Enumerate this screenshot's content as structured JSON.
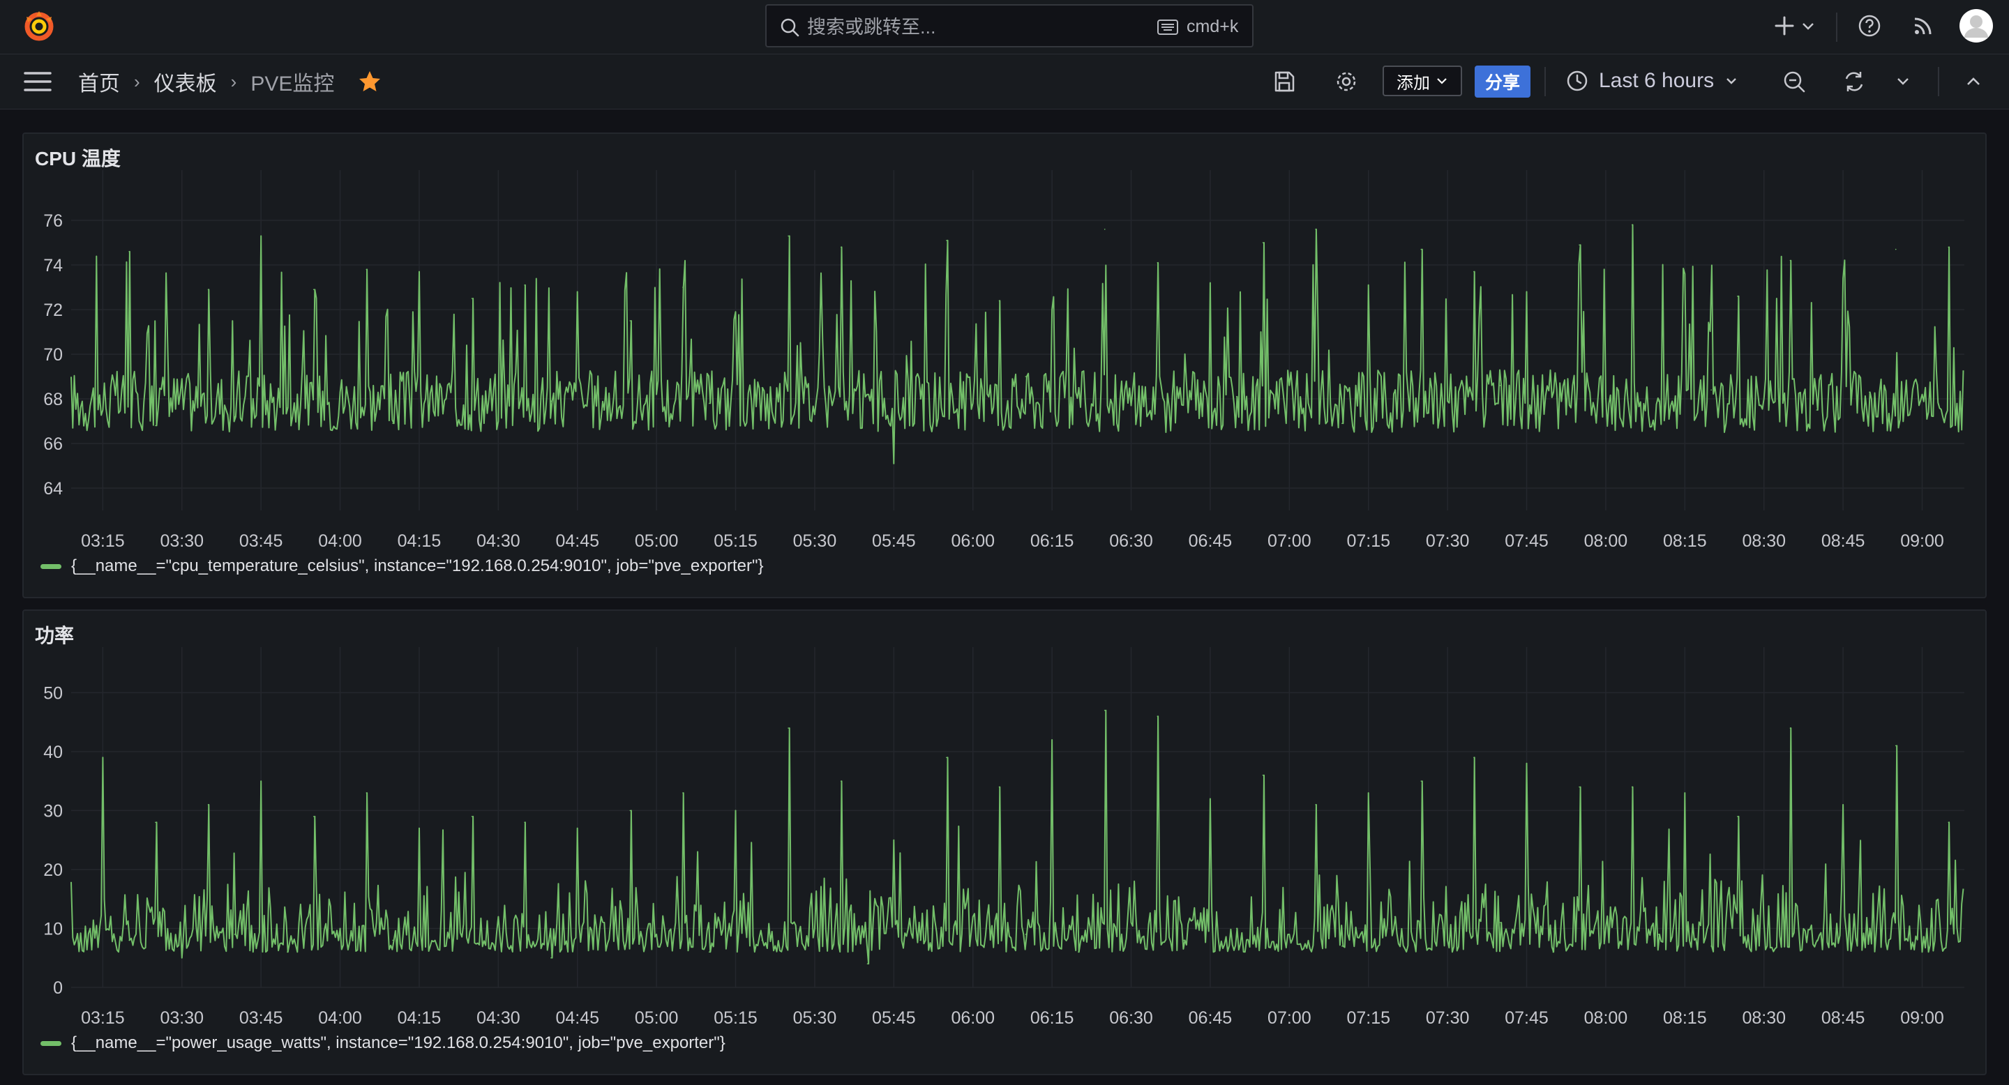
{
  "search": {
    "placeholder": "搜索或跳转至...",
    "shortcut": "cmd+k"
  },
  "breadcrumb": {
    "home": "首页",
    "dashboards": "仪表板",
    "current": "PVE监控"
  },
  "toolbar": {
    "add_label": "添加",
    "share_label": "分享",
    "time_range": "Last 6 hours"
  },
  "colors": {
    "accent_blue": "#3d71d9",
    "series_green": "#73bf69",
    "star_orange": "#ff9830",
    "panel_bg": "#181b1f",
    "page_bg": "#111217"
  },
  "icons": [
    "grafana-logo",
    "search-icon",
    "keyboard-icon",
    "plus-icon",
    "help-icon",
    "rss-icon",
    "avatar",
    "menu-icon",
    "star-icon",
    "save-icon",
    "gear-icon",
    "clock-icon",
    "zoom-out-icon",
    "refresh-icon",
    "chevron-down-icon",
    "chevron-up-icon"
  ],
  "panels": [
    {
      "title": "CPU 温度",
      "legend": "{__name__=\"cpu_temperature_celsius\", instance=\"192.168.0.254:9010\", job=\"pve_exporter\"}"
    },
    {
      "title": "功率",
      "legend": "{__name__=\"power_usage_watts\", instance=\"192.168.0.254:9010\", job=\"pve_exporter\"}"
    }
  ],
  "chart_data": [
    {
      "type": "line",
      "title": "CPU 温度",
      "x_ticks": [
        "03:15",
        "03:30",
        "03:45",
        "04:00",
        "04:15",
        "04:30",
        "04:45",
        "05:00",
        "05:15",
        "05:30",
        "05:45",
        "06:00",
        "06:15",
        "06:30",
        "06:45",
        "07:00",
        "07:15",
        "07:30",
        "07:45",
        "08:00",
        "08:15",
        "08:30",
        "08:45",
        "09:00"
      ],
      "y_ticks": [
        64,
        66,
        68,
        70,
        72,
        74,
        76
      ],
      "ylim": [
        63,
        77
      ],
      "xlim": [
        "03:09",
        "09:08"
      ],
      "grid": true,
      "legend_position": "bottom-left",
      "series": [
        {
          "name": "{__name__=\"cpu_temperature_celsius\", instance=\"192.168.0.254:9010\", job=\"pve_exporter\"}",
          "x": [
            "03:15",
            "03:20",
            "03:25",
            "03:30",
            "03:35",
            "03:40",
            "03:45",
            "03:50",
            "03:55",
            "04:00",
            "04:05",
            "04:10",
            "04:15",
            "04:20",
            "04:25",
            "04:30",
            "04:35",
            "04:40",
            "04:45",
            "04:50",
            "04:55",
            "05:00",
            "05:05",
            "05:10",
            "05:15",
            "05:20",
            "05:25",
            "05:30",
            "05:35",
            "05:40",
            "05:45",
            "05:50",
            "05:55",
            "06:00",
            "06:05",
            "06:10",
            "06:15",
            "06:20",
            "06:25",
            "06:30",
            "06:35",
            "06:40",
            "06:45",
            "06:50",
            "06:55",
            "07:00",
            "07:05",
            "07:10",
            "07:15",
            "07:20",
            "07:25",
            "07:30",
            "07:35",
            "07:40",
            "07:45",
            "07:50",
            "07:55",
            "08:00",
            "08:05",
            "08:10",
            "08:15",
            "08:20",
            "08:25",
            "08:30",
            "08:35",
            "08:40",
            "08:45",
            "08:50",
            "08:55",
            "09:00",
            "09:05"
          ],
          "values": [
            67.5,
            74.6,
            66.8,
            68.9,
            72.9,
            67.2,
            75.3,
            67.6,
            72.9,
            68.3,
            73.8,
            66.9,
            73.7,
            68.0,
            72.5,
            67.0,
            73.1,
            67.9,
            72.8,
            67.5,
            71.5,
            68.2,
            73.0,
            67.8,
            71.9,
            68.5,
            75.3,
            67.3,
            74.8,
            68.2,
            65.1,
            68.0,
            75.1,
            67.8,
            72.4,
            69.0,
            72.0,
            68.5,
            75.6,
            67.7,
            74.1,
            68.3,
            73.2,
            68.1,
            75.0,
            68.6,
            75.6,
            66.9,
            73.1,
            68.4,
            74.7,
            67.9,
            73.7,
            68.6,
            72.8,
            68.3,
            74.9,
            68.1,
            75.8,
            67.9,
            73.6,
            68.4,
            72.6,
            68.0,
            74.2,
            67.5,
            73.4,
            68.3,
            74.7,
            68.2,
            74.8
          ]
        }
      ]
    },
    {
      "type": "line",
      "title": "功率",
      "x_ticks": [
        "03:15",
        "03:30",
        "03:45",
        "04:00",
        "04:15",
        "04:30",
        "04:45",
        "05:00",
        "05:15",
        "05:30",
        "05:45",
        "06:00",
        "06:15",
        "06:30",
        "06:45",
        "07:00",
        "07:15",
        "07:30",
        "07:45",
        "08:00",
        "08:15",
        "08:30",
        "08:45",
        "09:00"
      ],
      "y_ticks": [
        0,
        10,
        20,
        30,
        40,
        50
      ],
      "ylim": [
        0,
        53
      ],
      "xlim": [
        "03:09",
        "09:08"
      ],
      "grid": true,
      "legend_position": "bottom-left",
      "series": [
        {
          "name": "{__name__=\"power_usage_watts\", instance=\"192.168.0.254:9010\", job=\"pve_exporter\"}",
          "x": [
            "03:15",
            "03:20",
            "03:25",
            "03:30",
            "03:35",
            "03:40",
            "03:45",
            "03:50",
            "03:55",
            "04:00",
            "04:05",
            "04:10",
            "04:15",
            "04:20",
            "04:25",
            "04:30",
            "04:35",
            "04:40",
            "04:45",
            "04:50",
            "04:55",
            "05:00",
            "05:05",
            "05:10",
            "05:15",
            "05:20",
            "05:25",
            "05:30",
            "05:35",
            "05:40",
            "05:45",
            "05:50",
            "05:55",
            "06:00",
            "06:05",
            "06:10",
            "06:15",
            "06:20",
            "06:25",
            "06:30",
            "06:35",
            "06:40",
            "06:45",
            "06:50",
            "06:55",
            "07:00",
            "07:05",
            "07:10",
            "07:15",
            "07:20",
            "07:25",
            "07:30",
            "07:35",
            "07:40",
            "07:45",
            "07:50",
            "07:55",
            "08:00",
            "08:05",
            "08:10",
            "08:15",
            "08:20",
            "08:25",
            "08:30",
            "08:35",
            "08:40",
            "08:45",
            "08:50",
            "08:55",
            "09:00",
            "09:05"
          ],
          "values": [
            39,
            8,
            28,
            5,
            31,
            9,
            35,
            6,
            29,
            10,
            33,
            8,
            27,
            7,
            29,
            12,
            28,
            5,
            27,
            11,
            30,
            9,
            33,
            6,
            30,
            8,
            44,
            10,
            35,
            4,
            25,
            8,
            39,
            12,
            34,
            9,
            42,
            6,
            47,
            11,
            46,
            8,
            32,
            10,
            36,
            9,
            31,
            7,
            33,
            12,
            35,
            8,
            39,
            11,
            38,
            6,
            34,
            10,
            34,
            9,
            33,
            7,
            29,
            11,
            44,
            8,
            31,
            10,
            41,
            6,
            28
          ]
        }
      ]
    }
  ]
}
